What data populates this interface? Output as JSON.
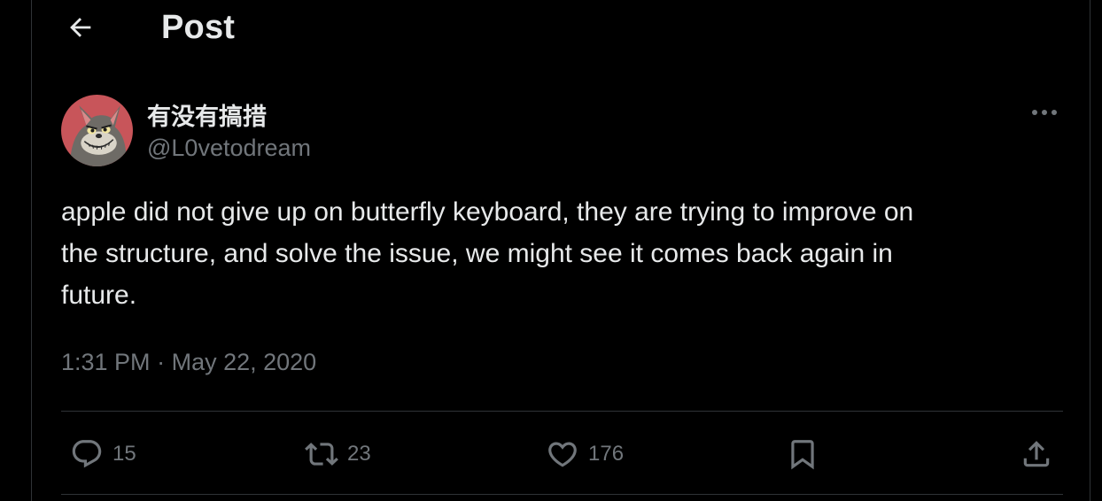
{
  "header": {
    "title": "Post",
    "back_icon": "arrow-left-icon"
  },
  "author": {
    "display_name": "有没有搞措",
    "handle": "@L0vetodream",
    "avatar_icon": "cartoon-cat-avatar",
    "more_icon": "ellipsis-icon"
  },
  "post": {
    "text": "apple did not give up on butterfly keyboard, they are trying to improve on\nthe structure, and solve the issue, we might see it comes back again in\nfuture.",
    "time": "1:31 PM",
    "separator": "·",
    "date": "May 22, 2020"
  },
  "actions": {
    "reply": {
      "icon": "reply-icon",
      "count": "15"
    },
    "repost": {
      "icon": "repost-icon",
      "count": "23"
    },
    "like": {
      "icon": "heart-icon",
      "count": "176"
    },
    "bookmark": {
      "icon": "bookmark-icon"
    },
    "share": {
      "icon": "share-icon"
    }
  },
  "colors": {
    "background": "#000000",
    "text_primary": "#e7e9ea",
    "text_secondary": "#71767b",
    "divider": "#2f3336",
    "avatar_bg": "#c8555a"
  }
}
